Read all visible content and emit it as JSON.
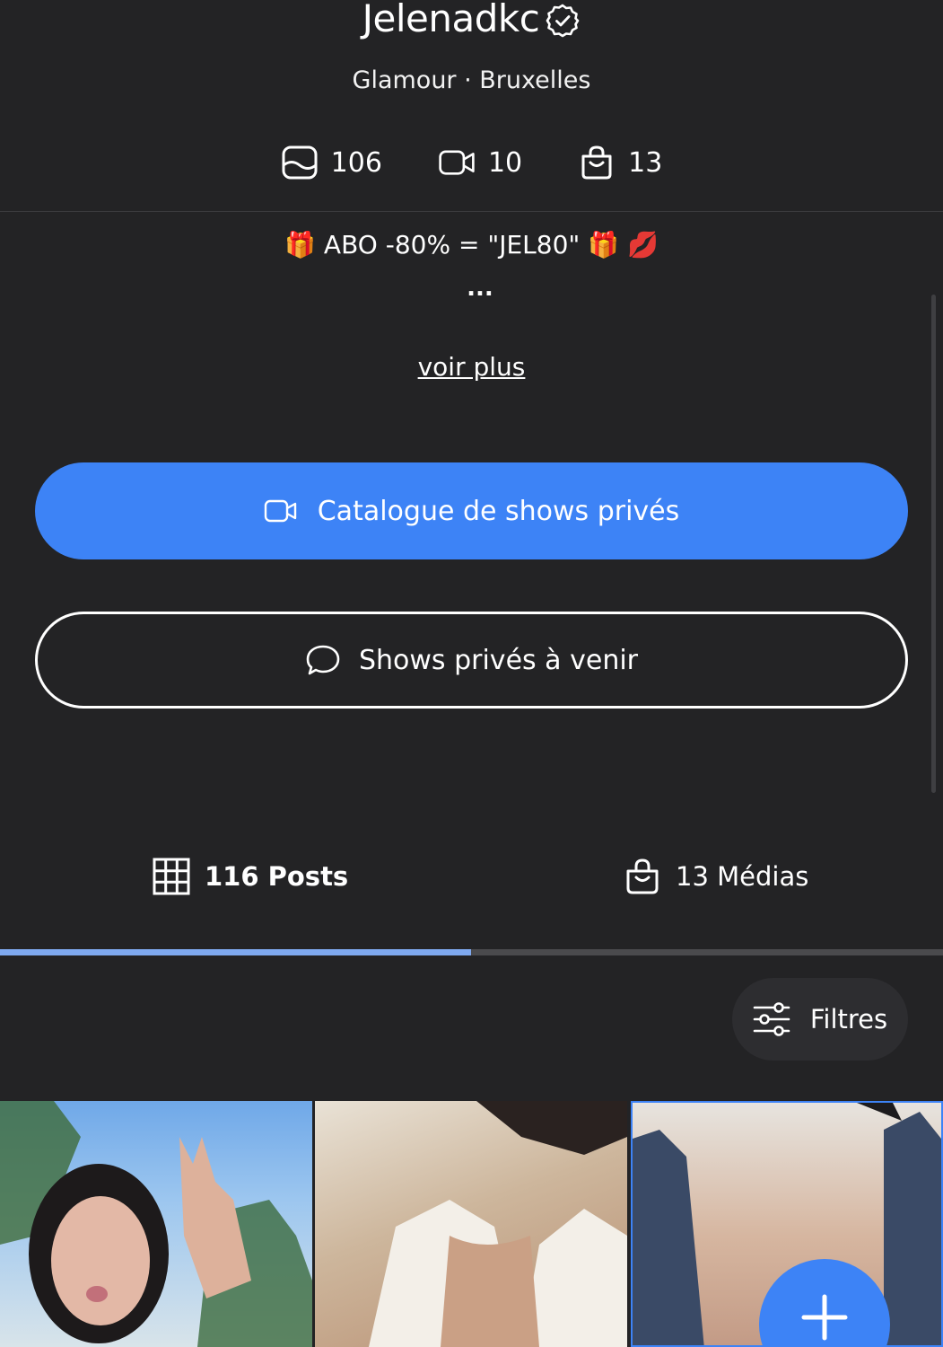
{
  "profile": {
    "name": "Jelenadkc",
    "subtitle": "Glamour · Bruxelles",
    "verified": true
  },
  "stats": {
    "photos": "106",
    "videos": "10",
    "medias": "13"
  },
  "bio": {
    "text": "🎁 ABO -80% = \"JEL80\" 🎁 💋",
    "ellipsis": "...",
    "more_link": "voir plus"
  },
  "buttons": {
    "catalog": "Catalogue de shows privés",
    "upcoming": "Shows privés à venir",
    "filters": "Filtres"
  },
  "tabs": {
    "posts": "116 Posts",
    "medias": "13 Médias",
    "active": "posts"
  },
  "colors": {
    "background": "#232325",
    "accent": "#3d83f6",
    "tab_indicator": "#7fa9ef"
  },
  "icons": {
    "verified": "verified-badge-icon",
    "photo": "photo-icon",
    "video": "video-camera-icon",
    "bag": "shopping-bag-icon",
    "chat": "chat-bubble-icon",
    "grid": "grid-icon",
    "filters": "sliders-icon",
    "add": "plus-icon"
  }
}
